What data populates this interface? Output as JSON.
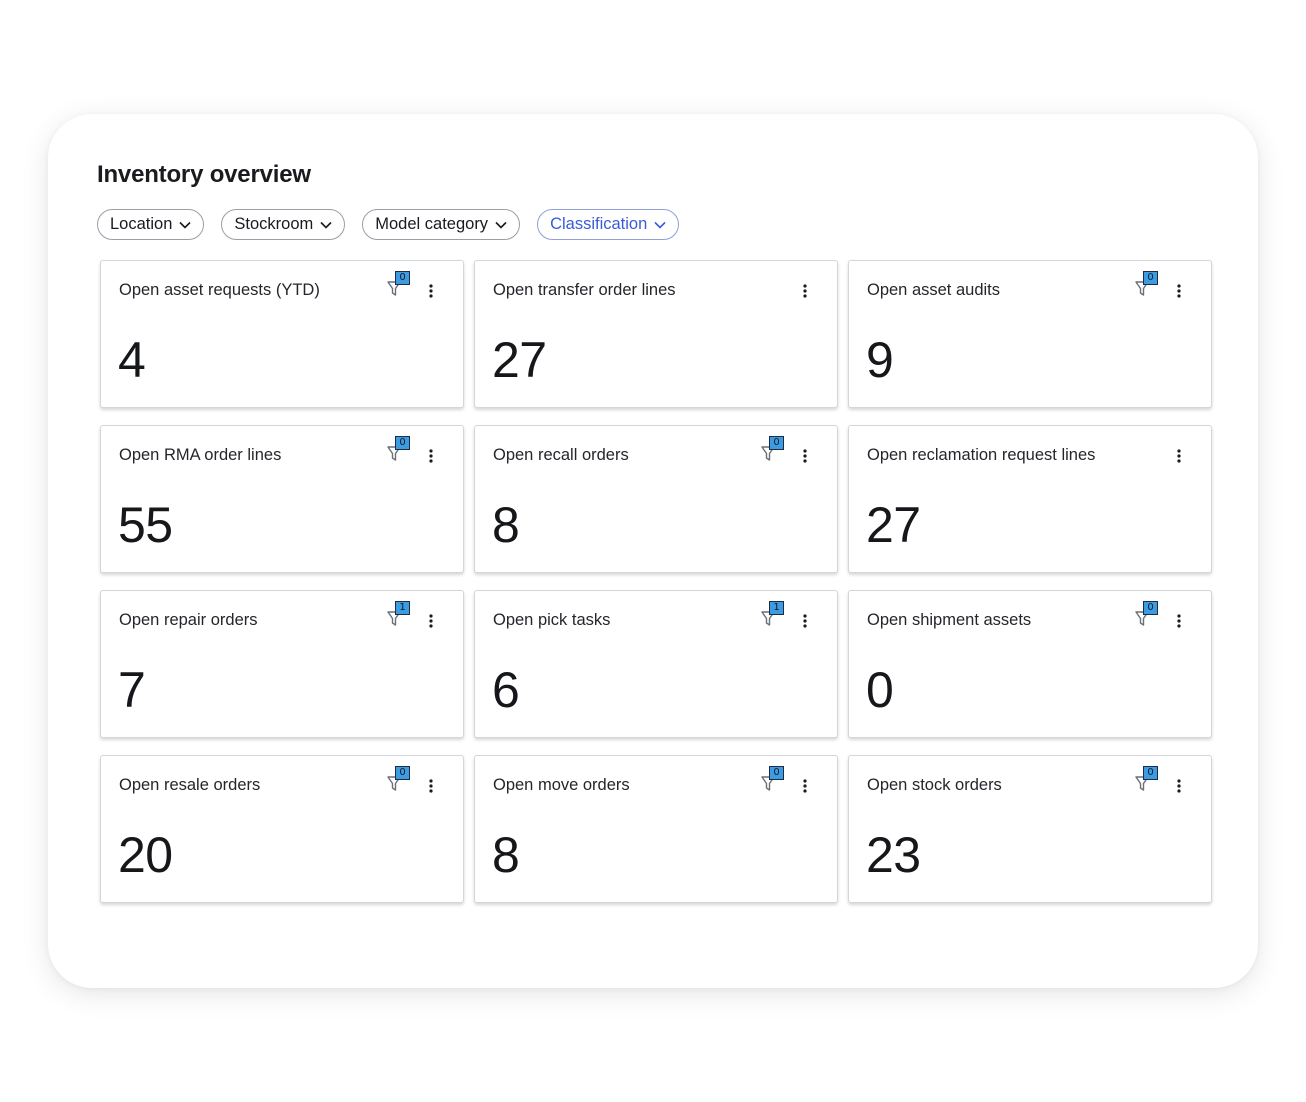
{
  "page": {
    "title": "Inventory overview"
  },
  "filters": [
    {
      "label": "Location"
    },
    {
      "label": "Stockroom"
    },
    {
      "label": "Model category"
    },
    {
      "label": "Classification"
    }
  ],
  "colors": {
    "accent": "#3b5bd9",
    "badge": "#3d9be0"
  },
  "cards": [
    {
      "title": "Open asset requests (YTD)",
      "value": "4",
      "filter_count": "0"
    },
    {
      "title": "Open transfer order lines",
      "value": "27"
    },
    {
      "title": "Open asset audits",
      "value": "9",
      "filter_count": "0"
    },
    {
      "title": "Open RMA order lines",
      "value": "55",
      "filter_count": "0"
    },
    {
      "title": "Open recall orders",
      "value": "8",
      "filter_count": "0"
    },
    {
      "title": "Open reclamation request lines",
      "value": "27"
    },
    {
      "title": "Open repair orders",
      "value": "7",
      "filter_count": "1"
    },
    {
      "title": "Open pick tasks",
      "value": "6",
      "filter_count": "1"
    },
    {
      "title": "Open shipment assets",
      "value": "0",
      "filter_count": "0"
    },
    {
      "title": "Open resale orders",
      "value": "20",
      "filter_count": "0"
    },
    {
      "title": "Open move orders",
      "value": "8",
      "filter_count": "0"
    },
    {
      "title": "Open stock orders",
      "value": "23",
      "filter_count": "0"
    }
  ]
}
